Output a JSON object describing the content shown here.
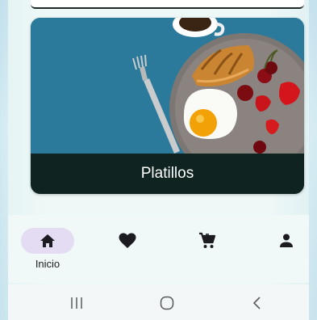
{
  "card": {
    "title": "Platillos"
  },
  "bottom_nav": {
    "items": [
      {
        "label": "Inicio",
        "icon": "home-icon",
        "active": true
      },
      {
        "label": "",
        "icon": "heart-icon",
        "active": false
      },
      {
        "label": "",
        "icon": "cart-icon",
        "active": false
      },
      {
        "label": "",
        "icon": "person-icon",
        "active": false
      }
    ]
  },
  "colors": {
    "accent_pill": "#e3dcf2",
    "card_label_bg": "#0f2420",
    "photo_bg": "#2f7fa0"
  },
  "system_bar": {
    "buttons": [
      "recent-apps-icon",
      "home-circle-icon",
      "back-icon"
    ]
  }
}
